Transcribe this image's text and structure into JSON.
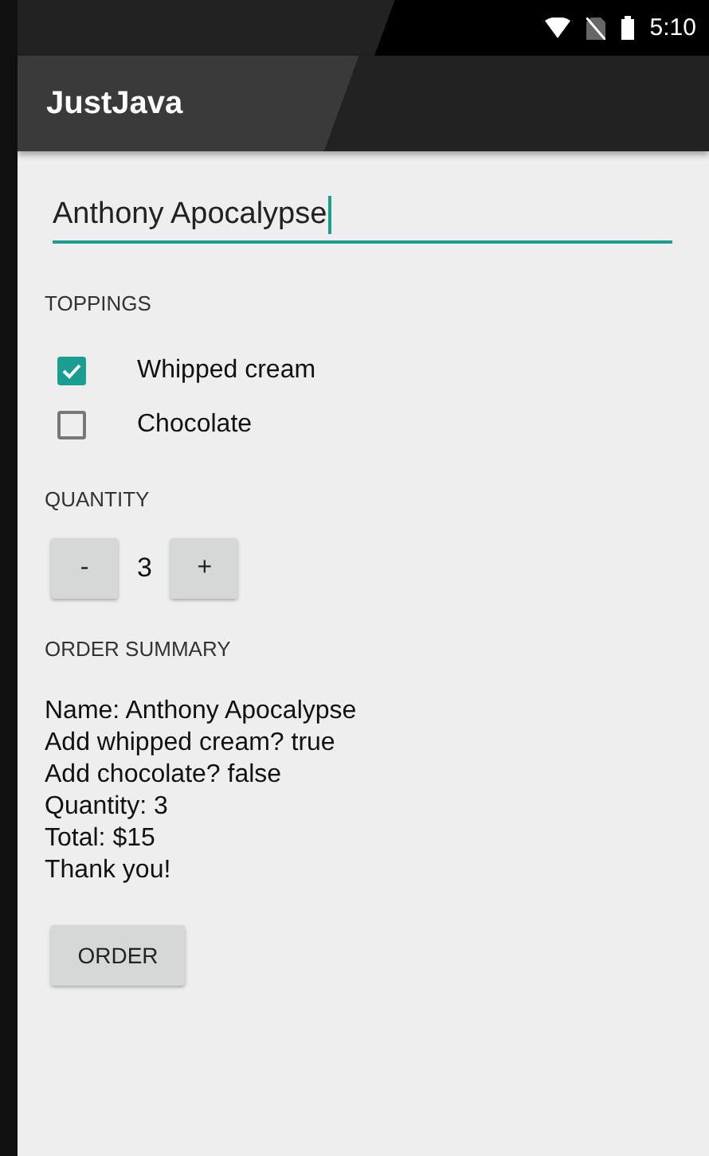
{
  "status_bar": {
    "time": "5:10"
  },
  "app_bar": {
    "title": "JustJava"
  },
  "name_field": {
    "value": "Anthony Apocalypse",
    "focused": true
  },
  "toppings": {
    "heading": "TOPPINGS",
    "items": [
      {
        "label": "Whipped cream",
        "checked": true
      },
      {
        "label": "Chocolate",
        "checked": false
      }
    ]
  },
  "quantity": {
    "heading": "QUANTITY",
    "decrement": "-",
    "value": "3",
    "increment": "+"
  },
  "order_summary": {
    "heading": "ORDER SUMMARY",
    "lines": [
      "Name: Anthony Apocalypse",
      "Add whipped cream? true",
      "Add chocolate? false",
      "Quantity: 3",
      "Total: $15",
      "Thank you!"
    ]
  },
  "order_button": "ORDER"
}
